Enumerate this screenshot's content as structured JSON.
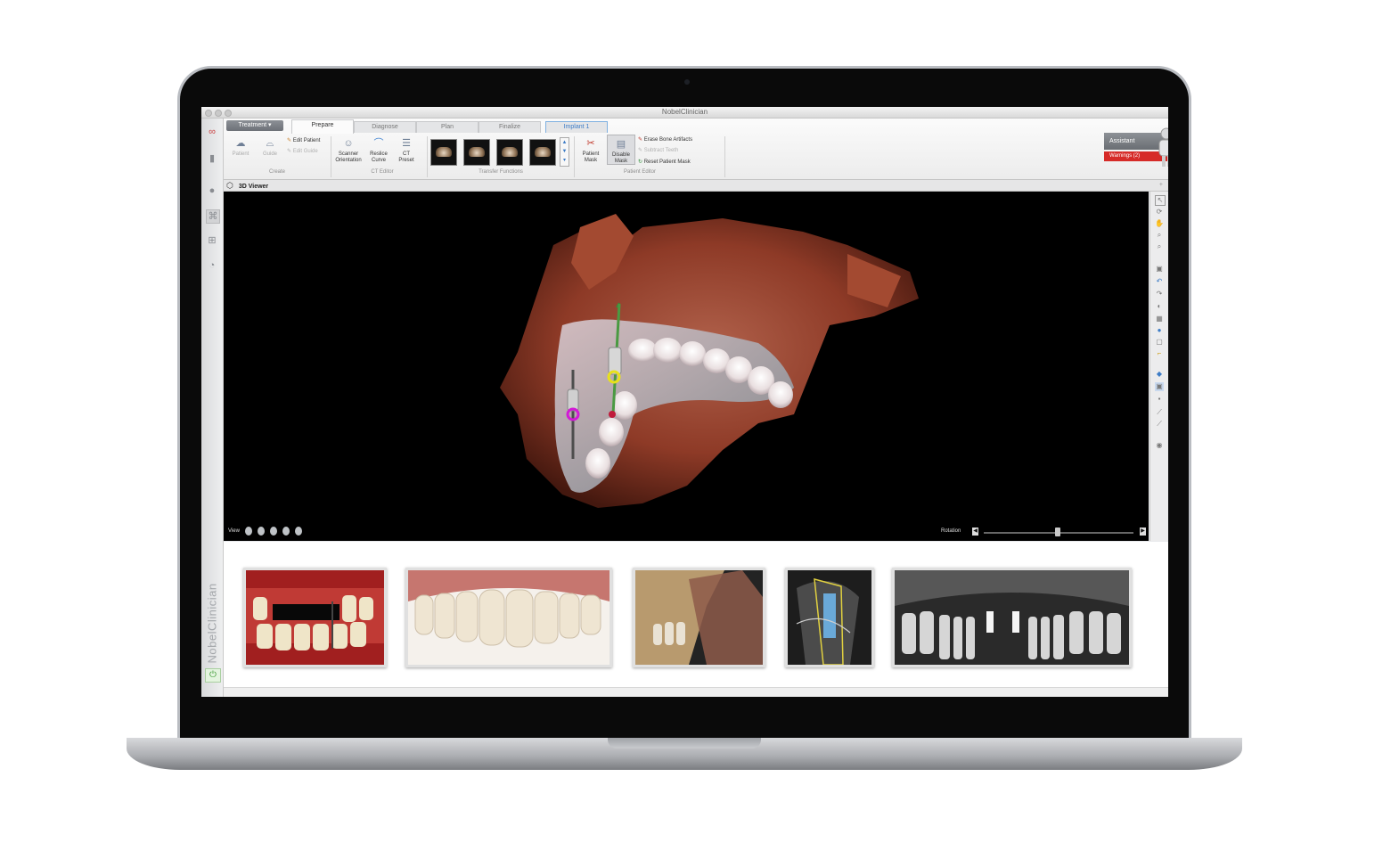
{
  "app": {
    "title": "NobelClinician",
    "brand_vertical": "NobelClinician"
  },
  "tabs": {
    "treatment": "Treatment",
    "prepare": "Prepare",
    "diagnose": "Diagnose",
    "plan": "Plan",
    "finalize": "Finalize",
    "implant": "Implant 1"
  },
  "create_group": {
    "patient": "Patient",
    "guide": "Guide",
    "edit_patient": "Edit Patient",
    "edit_guide": "Edit Guide",
    "label": "Create"
  },
  "ct_editor": {
    "scanner_orientation": "Scanner Orientation",
    "reslice_curve": "Reslice Curve",
    "ct_preset": "CT Preset",
    "label": "CT Editor"
  },
  "transfer_functions": {
    "label": "Transfer Functions"
  },
  "patient_editor": {
    "patient_mask": "Patient Mask",
    "disable_mask": "Disable Mask",
    "erase_bone_artifacts": "Erase Bone Artifacts",
    "subtract_teeth": "Subtract Teeth",
    "reset_patient_mask": "Reset Patient Mask",
    "label": "Patient Editor"
  },
  "assistant": {
    "label": "Assistant",
    "warnings": "Warnings (2)"
  },
  "viewer": {
    "title": "3D Viewer",
    "view_label": "View",
    "rotation_label": "Rotation",
    "rotation_value": 0.5
  },
  "colors": {
    "implant_magenta": "#d21ad6",
    "implant_yellow": "#e8e11a",
    "bone": "#b04a30"
  }
}
